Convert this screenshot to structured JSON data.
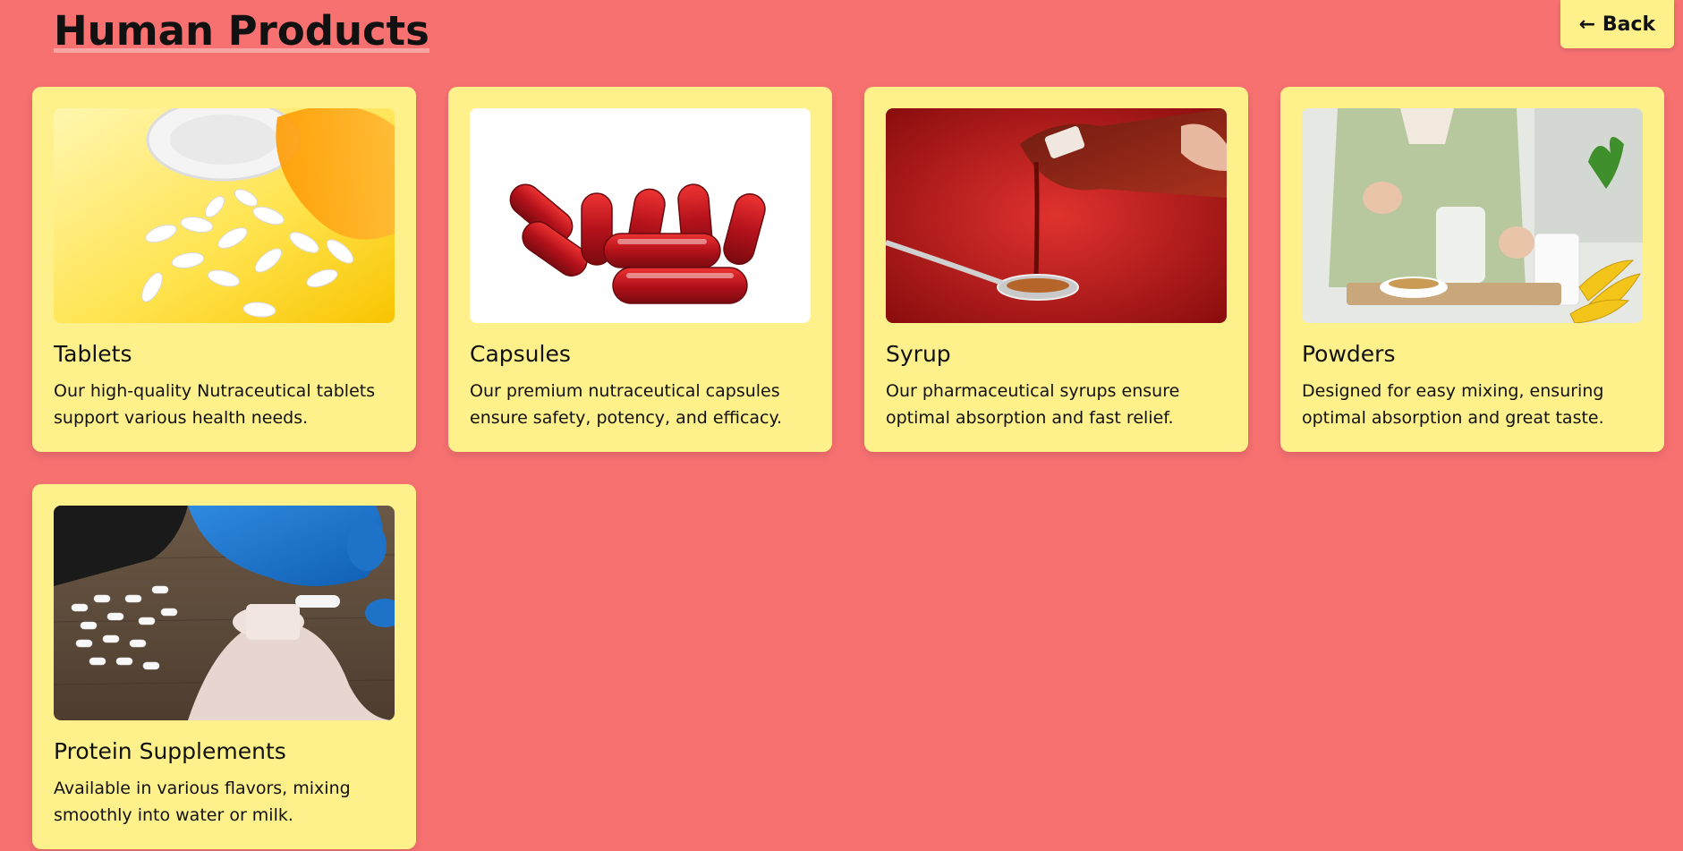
{
  "page": {
    "title": "Human Products",
    "back_label": "← Back"
  },
  "products": [
    {
      "name": "Tablets",
      "description": "Our high-quality Nutraceutical tablets support various health needs."
    },
    {
      "name": "Capsules",
      "description": "Our premium nutraceutical capsules ensure safety, potency, and efficacy."
    },
    {
      "name": "Syrup",
      "description": "Our pharmaceutical syrups ensure optimal absorption and fast relief."
    },
    {
      "name": "Powders",
      "description": "Designed for easy mixing, ensuring optimal absorption and great taste."
    },
    {
      "name": "Protein Supplements",
      "description": "Available in various flavors, mixing smoothly into water or milk."
    }
  ],
  "colors": {
    "background": "#f87171",
    "card": "#fef08a",
    "text": "#111111"
  }
}
